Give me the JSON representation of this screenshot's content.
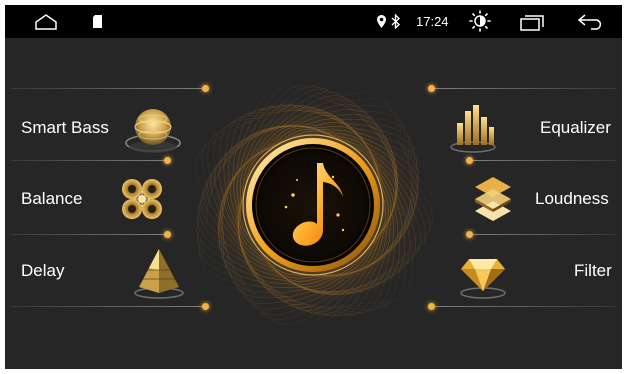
{
  "status_bar": {
    "time": "17:24",
    "icons": [
      "home-icon",
      "sd-card-icon",
      "location-pin-icon",
      "bluetooth-icon",
      "brightness-icon",
      "recent-apps-icon",
      "back-icon"
    ]
  },
  "menu": {
    "left": [
      {
        "label": "Smart Bass",
        "icon": "smart-bass-icon"
      },
      {
        "label": "Balance",
        "icon": "balance-icon"
      },
      {
        "label": "Delay",
        "icon": "delay-pyramid-icon"
      }
    ],
    "right": [
      {
        "label": "Equalizer",
        "icon": "equalizer-icon"
      },
      {
        "label": "Loudness",
        "icon": "loudness-icon"
      },
      {
        "label": "Filter",
        "icon": "filter-gem-icon"
      }
    ]
  },
  "center": {
    "icon": "music-note-icon"
  },
  "colors": {
    "accent": "#f4a321",
    "background": "#262626",
    "status_bar": "#000000"
  }
}
